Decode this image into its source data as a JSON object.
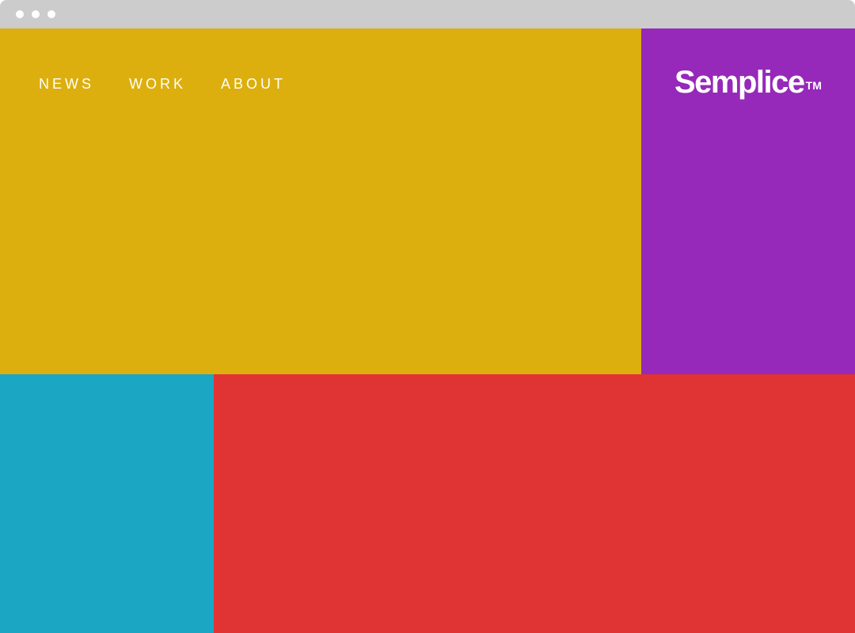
{
  "browser": {
    "titlebar_color": "#cccccc",
    "dots": [
      "dot",
      "dot",
      "dot"
    ]
  },
  "nav": {
    "items": [
      {
        "label": "NEWS"
      },
      {
        "label": "WORK"
      },
      {
        "label": "ABOUT"
      }
    ]
  },
  "brand": {
    "name": "Semplice",
    "trademark": "TM"
  },
  "colors": {
    "yellow": "#dcaf0e",
    "purple": "#9629b9",
    "blue": "#1ba6c4",
    "red": "#e03334",
    "text": "#ffffff"
  }
}
